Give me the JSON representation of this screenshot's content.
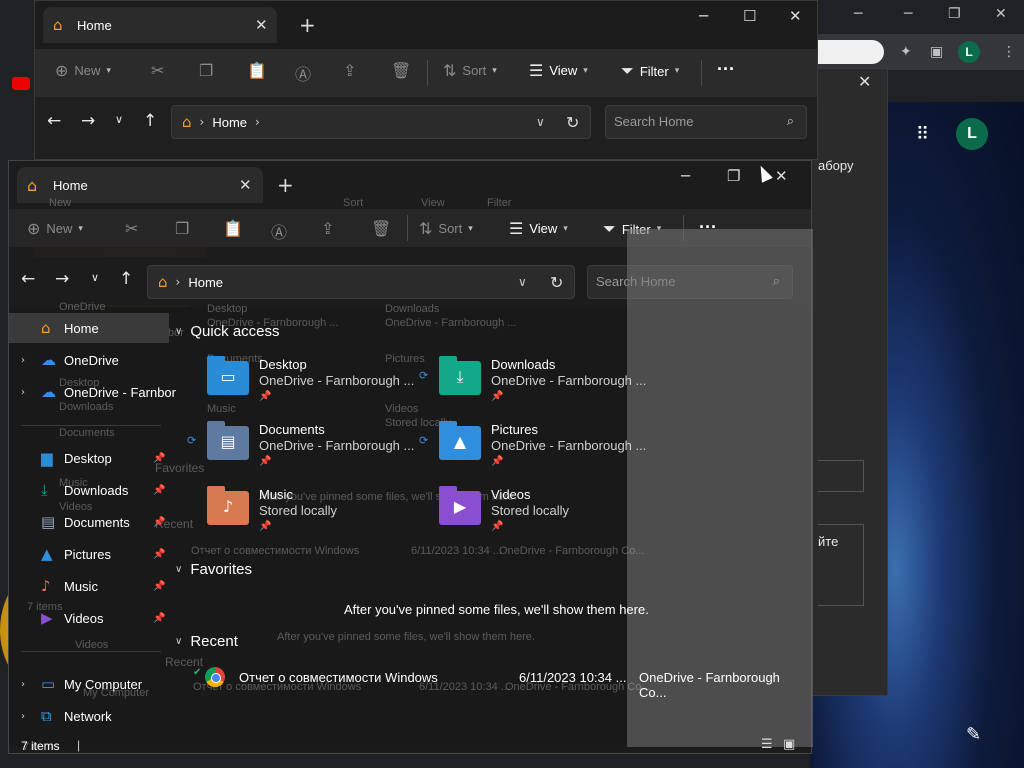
{
  "background_browser": {
    "avatar_letter": "L",
    "page_text_1": "абору",
    "page_text_2": "йте"
  },
  "window_back": {
    "tab_label": "Home",
    "new_label": "New",
    "sort_label": "Sort",
    "view_label": "View",
    "filter_label": "Filter",
    "breadcrumb": "Home",
    "search_placeholder": "Search Home"
  },
  "window_front": {
    "tab_label": "Home",
    "new_label": "New",
    "sort_label": "Sort",
    "view_label": "View",
    "filter_label": "Filter",
    "breadcrumb": "Home",
    "search_placeholder": "Search Home",
    "sidebar": {
      "items": [
        {
          "label": "Home",
          "icon": "home-icon"
        },
        {
          "label": "OneDrive",
          "icon": "cloud-icon"
        },
        {
          "label": "OneDrive - Farnbor",
          "icon": "cloud-icon"
        },
        {
          "label": "Desktop",
          "icon": "desktop-icon"
        },
        {
          "label": "Downloads",
          "icon": "download-icon"
        },
        {
          "label": "Documents",
          "icon": "documents-icon"
        },
        {
          "label": "Pictures",
          "icon": "pictures-icon"
        },
        {
          "label": "Music",
          "icon": "music-icon"
        },
        {
          "label": "Videos",
          "icon": "videos-icon"
        },
        {
          "label": "My Computer",
          "icon": "computer-icon"
        },
        {
          "label": "Network",
          "icon": "network-icon"
        }
      ]
    },
    "quick_access": {
      "heading": "Quick access",
      "items": [
        {
          "name": "Desktop",
          "location": "OneDrive - Farnborough ...",
          "color": "#2a8bd6"
        },
        {
          "name": "Downloads",
          "location": "OneDrive - Farnborough ...",
          "color": "#12a88a"
        },
        {
          "name": "Documents",
          "location": "OneDrive - Farnborough ...",
          "color": "#5f7aa0"
        },
        {
          "name": "Pictures",
          "location": "OneDrive - Farnborough ...",
          "color": "#2f8fde"
        },
        {
          "name": "Music",
          "location": "Stored locally",
          "color": "#d77a52"
        },
        {
          "name": "Videos",
          "location": "Stored locally",
          "color": "#8a4fd0"
        }
      ]
    },
    "favorites": {
      "heading": "Favorites",
      "empty_message": "After you've pinned some files, we'll show them here."
    },
    "recent": {
      "heading": "Recent",
      "rows": [
        {
          "name": "Отчет о совместимости Windows",
          "date": "6/11/2023 10:34 ...",
          "location": "OneDrive - Farnborough Co..."
        }
      ]
    },
    "status": {
      "item_count": "7 items"
    },
    "ghost": {
      "new": "New",
      "sort": "Sort",
      "view": "View",
      "filter": "Filter",
      "home": "Home",
      "search": "Search Home",
      "desktop": "Desktop",
      "downloads": "Downloads",
      "documents": "Documents",
      "pictures": "Pictures",
      "music": "Music",
      "videos": "Videos",
      "onedrive_fb": "OneDrive - Farnborough ...",
      "stored": "Stored locally",
      "favorites": "Favorites",
      "recent": "Recent",
      "pinned_msg": "After you've pinned some files, we'll show them here.",
      "recent_name": "Отчет о совместимости Windows",
      "recent_date": "6/11/2023 10:34 ...",
      "recent_loc": "OneDrive - Farnborough Co...",
      "items": "7 items",
      "home_sb": "Home",
      "onedrive_sb": "OneDrive",
      "onedrive_farnbor": "OneDrive - Farnbor",
      "my_computer": "My Computer"
    }
  }
}
